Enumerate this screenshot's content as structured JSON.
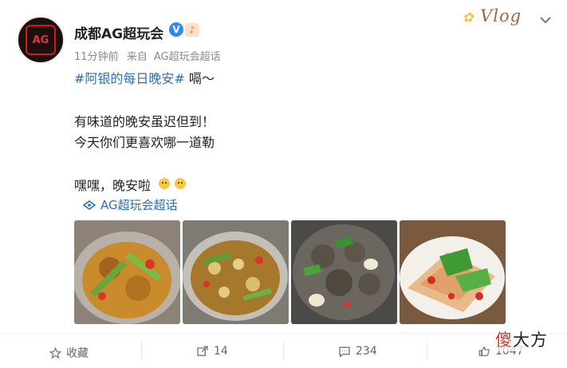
{
  "post_header": {
    "username": "成都AG超玩会",
    "verified_mark": "V",
    "badge_text": "♪",
    "time": "11分钟前",
    "source_prefix": "来自",
    "source_name": "AG超玩会超话",
    "vlog_label": "Vlog"
  },
  "avatar": {
    "logo_text": "AG"
  },
  "post_body": {
    "topic": "#阿银的每日晚安#",
    "line1_suffix": " 嗝～",
    "line2": "有味道的晚安虽迟但到！",
    "line3": "今天你们更喜欢哪一道勒",
    "line4": "嘿嘿，晚安啦"
  },
  "super_topic": {
    "label": "AG超玩会超话"
  },
  "photos": [
    "food-photo-1",
    "food-photo-2",
    "food-photo-3",
    "food-photo-4"
  ],
  "actions": {
    "favorite_label": "收藏",
    "repost_count": "14",
    "comment_count": "234",
    "like_count": "1047"
  },
  "watermark": {
    "first_char": "傻",
    "rest": "大方"
  }
}
